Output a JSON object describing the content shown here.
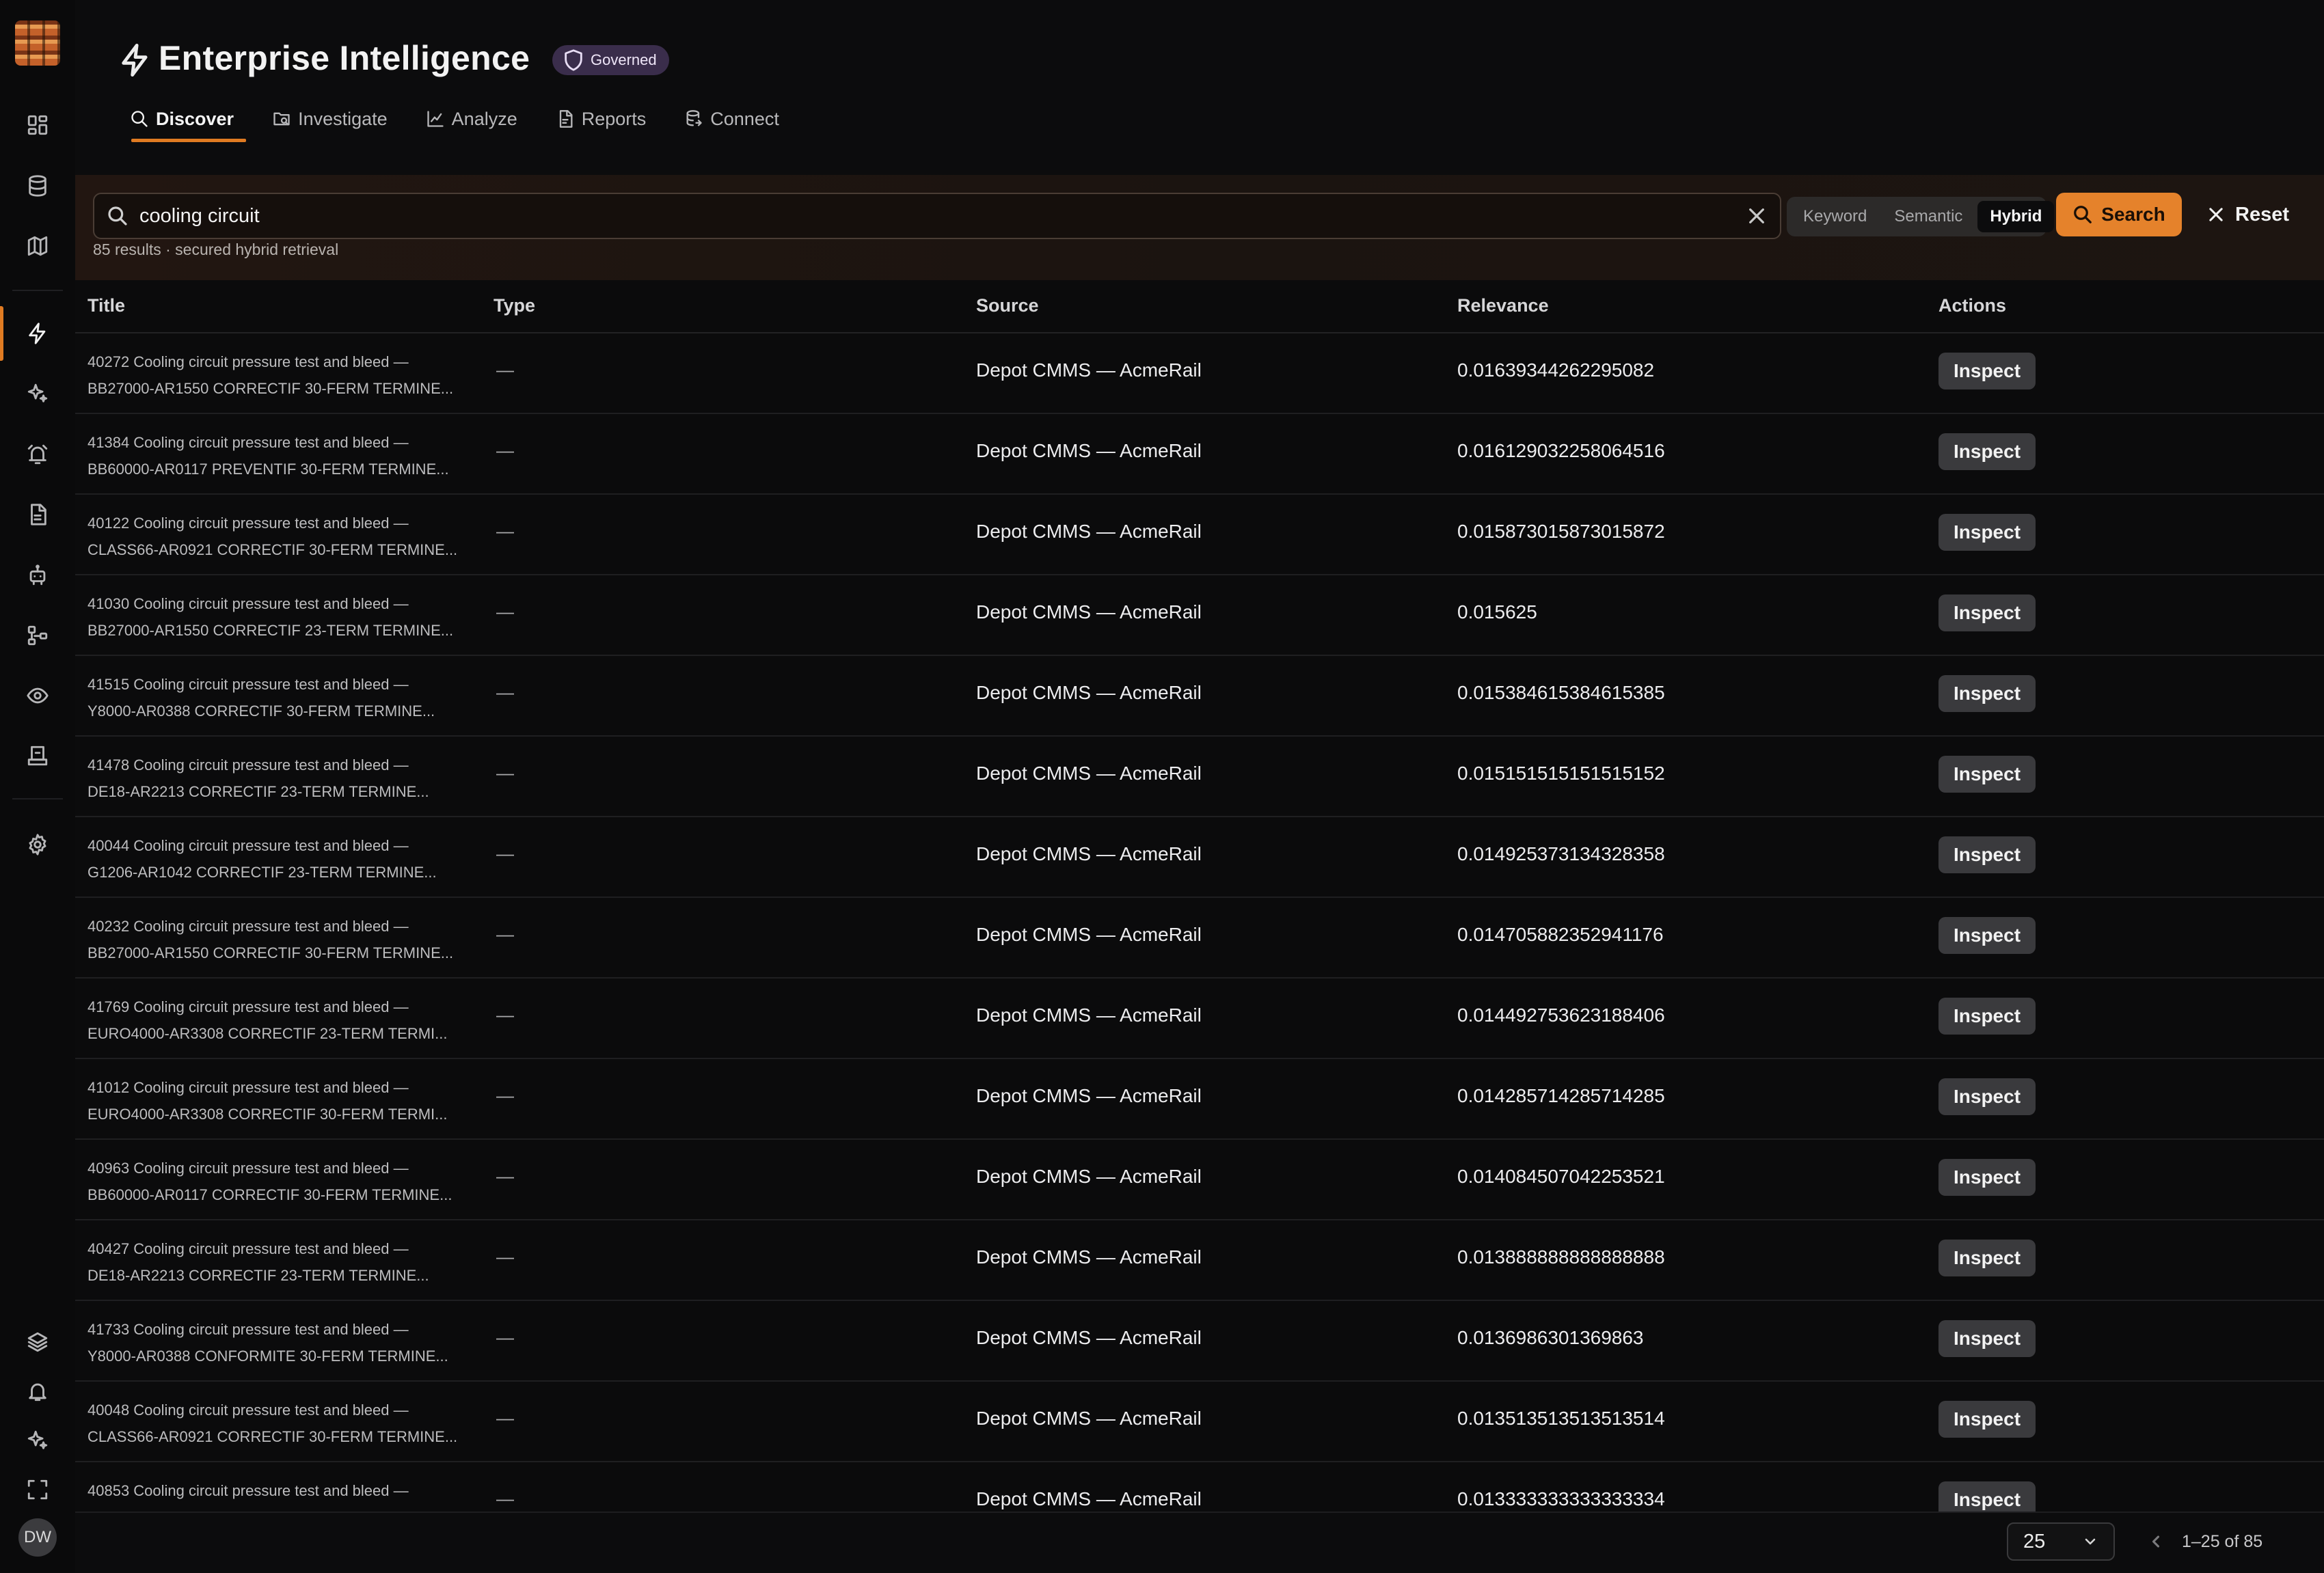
{
  "app": {
    "title": "Enterprise Intelligence",
    "badge": "Governed",
    "accent_color": "#e07b22",
    "badge_color": "#3a2d4b",
    "user_initials": "DW"
  },
  "sidebar": {
    "items": [
      {
        "icon": "dashboard-icon"
      },
      {
        "icon": "database-icon"
      },
      {
        "icon": "map-icon"
      },
      {
        "icon": "bolt-icon",
        "active": true
      },
      {
        "icon": "sparkles-icon"
      },
      {
        "icon": "alarm-icon"
      },
      {
        "icon": "document-icon"
      },
      {
        "icon": "robot-icon"
      },
      {
        "icon": "workflow-icon"
      },
      {
        "icon": "eye-icon"
      },
      {
        "icon": "inbox-icon"
      },
      {
        "icon": "gear-icon"
      }
    ],
    "bottom_items": [
      {
        "icon": "layers-icon"
      },
      {
        "icon": "bell-icon"
      },
      {
        "icon": "sparkles-icon"
      },
      {
        "icon": "fullscreen-icon"
      }
    ]
  },
  "tabs": [
    {
      "label": "Discover",
      "icon": "search-icon",
      "active": true
    },
    {
      "label": "Investigate",
      "icon": "folder-search-icon"
    },
    {
      "label": "Analyze",
      "icon": "chart-icon"
    },
    {
      "label": "Reports",
      "icon": "file-icon"
    },
    {
      "label": "Connect",
      "icon": "database-link-icon"
    }
  ],
  "search": {
    "value": "cooling circuit",
    "meta": "85 results · secured hybrid retrieval",
    "modes": [
      "Keyword",
      "Semantic",
      "Hybrid"
    ],
    "active_mode": "Hybrid",
    "search_label": "Search",
    "reset_label": "Reset"
  },
  "table": {
    "columns": [
      "Title",
      "Type",
      "Source",
      "Relevance",
      "Actions"
    ],
    "rows": [
      {
        "title1": "40272 Cooling circuit pressure test and bleed —",
        "title2": "BB27000-AR1550 CORRECTIF 30-FERM TERMINE...",
        "type": "—",
        "source": "Depot CMMS — AcmeRail",
        "relevance": "0.01639344262295082",
        "action": "Inspect"
      },
      {
        "title1": "41384 Cooling circuit pressure test and bleed —",
        "title2": "BB60000-AR0117 PREVENTIF 30-FERM TERMINE...",
        "type": "—",
        "source": "Depot CMMS — AcmeRail",
        "relevance": "0.016129032258064516",
        "action": "Inspect"
      },
      {
        "title1": "40122 Cooling circuit pressure test and bleed —",
        "title2": "CLASS66-AR0921 CORRECTIF 30-FERM TERMINE...",
        "type": "—",
        "source": "Depot CMMS — AcmeRail",
        "relevance": "0.015873015873015872",
        "action": "Inspect"
      },
      {
        "title1": "41030 Cooling circuit pressure test and bleed —",
        "title2": "BB27000-AR1550 CORRECTIF 23-TERM TERMINE...",
        "type": "—",
        "source": "Depot CMMS — AcmeRail",
        "relevance": "0.015625",
        "action": "Inspect"
      },
      {
        "title1": "41515 Cooling circuit pressure test and bleed —",
        "title2": "Y8000-AR0388 CORRECTIF 30-FERM TERMINE...",
        "type": "—",
        "source": "Depot CMMS — AcmeRail",
        "relevance": "0.015384615384615385",
        "action": "Inspect"
      },
      {
        "title1": "41478 Cooling circuit pressure test and bleed —",
        "title2": "DE18-AR2213 CORRECTIF 23-TERM TERMINE...",
        "type": "—",
        "source": "Depot CMMS — AcmeRail",
        "relevance": "0.015151515151515152",
        "action": "Inspect"
      },
      {
        "title1": "40044 Cooling circuit pressure test and bleed —",
        "title2": "G1206-AR1042 CORRECTIF 23-TERM TERMINE...",
        "type": "—",
        "source": "Depot CMMS — AcmeRail",
        "relevance": "0.014925373134328358",
        "action": "Inspect"
      },
      {
        "title1": "40232 Cooling circuit pressure test and bleed —",
        "title2": "BB27000-AR1550 CORRECTIF 30-FERM TERMINE...",
        "type": "—",
        "source": "Depot CMMS — AcmeRail",
        "relevance": "0.014705882352941176",
        "action": "Inspect"
      },
      {
        "title1": "41769 Cooling circuit pressure test and bleed —",
        "title2": "EURO4000-AR3308 CORRECTIF 23-TERM TERMI...",
        "type": "—",
        "source": "Depot CMMS — AcmeRail",
        "relevance": "0.014492753623188406",
        "action": "Inspect"
      },
      {
        "title1": "41012 Cooling circuit pressure test and bleed —",
        "title2": "EURO4000-AR3308 CORRECTIF 30-FERM TERMI...",
        "type": "—",
        "source": "Depot CMMS — AcmeRail",
        "relevance": "0.014285714285714285",
        "action": "Inspect"
      },
      {
        "title1": "40963 Cooling circuit pressure test and bleed —",
        "title2": "BB60000-AR0117 CORRECTIF 30-FERM TERMINE...",
        "type": "—",
        "source": "Depot CMMS — AcmeRail",
        "relevance": "0.014084507042253521",
        "action": "Inspect"
      },
      {
        "title1": "40427 Cooling circuit pressure test and bleed —",
        "title2": "DE18-AR2213 CORRECTIF 23-TERM TERMINE...",
        "type": "—",
        "source": "Depot CMMS — AcmeRail",
        "relevance": "0.013888888888888888",
        "action": "Inspect"
      },
      {
        "title1": "41733 Cooling circuit pressure test and bleed —",
        "title2": "Y8000-AR0388 CONFORMITE 30-FERM TERMINE...",
        "type": "—",
        "source": "Depot CMMS — AcmeRail",
        "relevance": "0.0136986301369863",
        "action": "Inspect"
      },
      {
        "title1": "40048 Cooling circuit pressure test and bleed —",
        "title2": "CLASS66-AR0921 CORRECTIF 30-FERM TERMINE...",
        "type": "—",
        "source": "Depot CMMS — AcmeRail",
        "relevance": "0.013513513513513514",
        "action": "Inspect"
      },
      {
        "title1": "40853 Cooling circuit pressure test and bleed —",
        "title2": "",
        "type": "—",
        "source": "Depot CMMS — AcmeRail",
        "relevance": "0.013333333333333334",
        "action": "Inspect"
      }
    ]
  },
  "pagination": {
    "page_size": "25",
    "range_text": "1–25 of 85"
  }
}
